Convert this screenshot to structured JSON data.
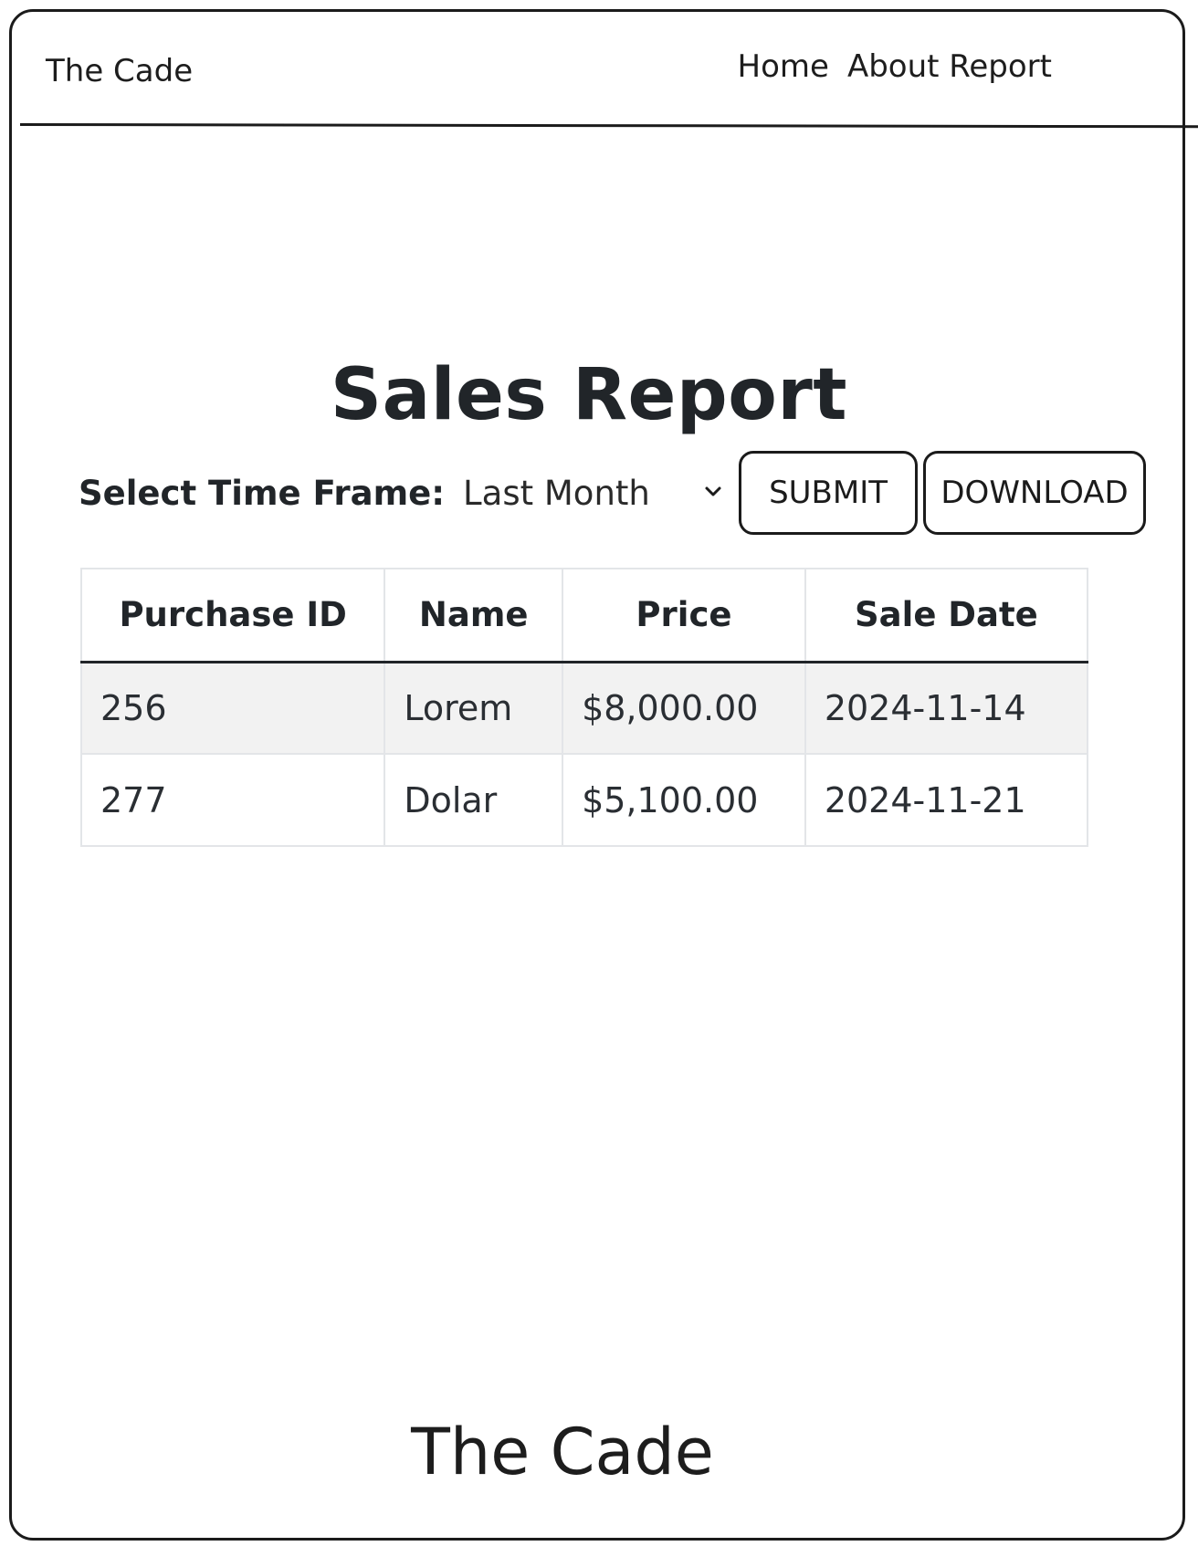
{
  "header": {
    "brand": "The Cade",
    "nav": [
      {
        "label": "Home"
      },
      {
        "label": "About Report"
      }
    ]
  },
  "main": {
    "title": "Sales Report",
    "time_frame_label": "Select Time Frame:",
    "time_frame_value": "Last Month",
    "submit_label": "SUBMIT",
    "download_label": "DOWNLOAD"
  },
  "table": {
    "columns": [
      "Purchase ID",
      "Name",
      "Price",
      "Sale Date"
    ],
    "rows": [
      {
        "purchase_id": "256",
        "name": "Lorem",
        "price": "$8,000.00",
        "sale_date": "2024-11-14"
      },
      {
        "purchase_id": "277",
        "name": "Dolar",
        "price": "$5,100.00",
        "sale_date": "2024-11-21"
      }
    ]
  },
  "footer": {
    "text": "The Cade"
  }
}
